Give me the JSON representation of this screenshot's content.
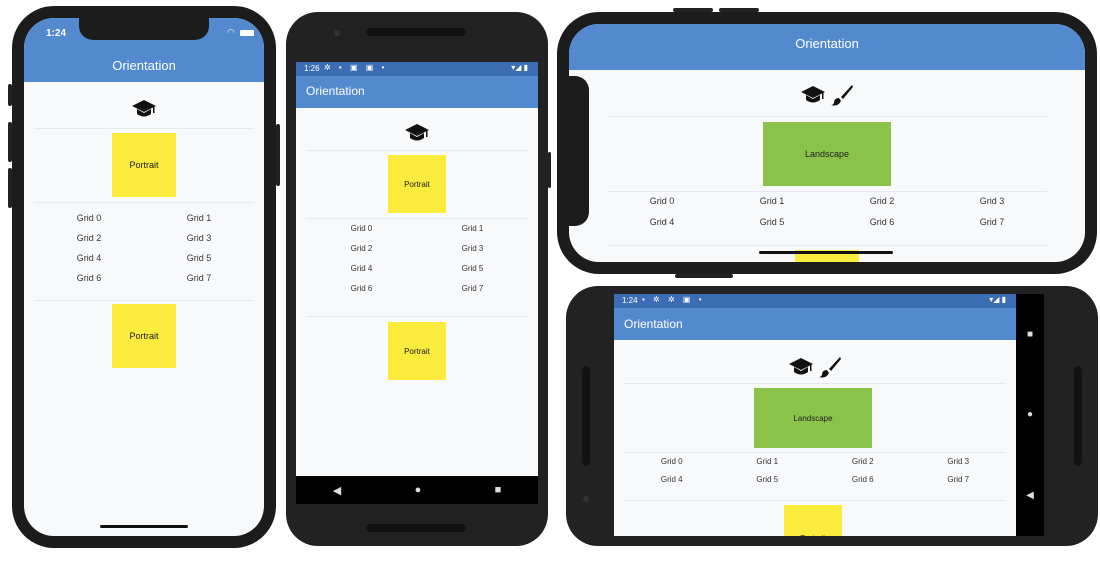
{
  "app": {
    "title": "Orientation"
  },
  "status": {
    "ios_time": "1:24",
    "android_time_portrait": "1:26",
    "android_time_landscape": "1:24"
  },
  "labels": {
    "portrait": "Portrait",
    "landscape": "Landscape"
  },
  "grid": [
    "Grid 0",
    "Grid 1",
    "Grid 2",
    "Grid 3",
    "Grid 4",
    "Grid 5",
    "Grid 6",
    "Grid 7"
  ],
  "icons": {
    "portrait": [
      "graduation-cap-icon"
    ],
    "landscape": [
      "graduation-cap-icon",
      "paint-brush-icon"
    ]
  },
  "colors": {
    "appbar": "#5289cf",
    "portrait_box": "#fbeb3c",
    "landscape_box": "#8bc34a"
  }
}
